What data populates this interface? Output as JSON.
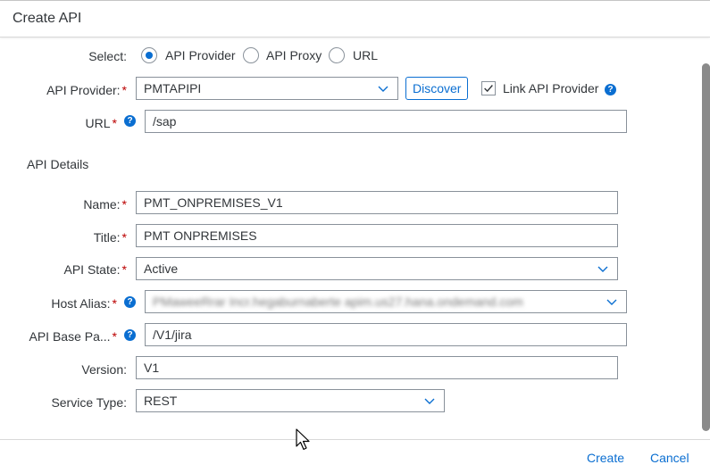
{
  "dialog": {
    "title": "Create API"
  },
  "select_row": {
    "label": "Select:",
    "options": [
      "API Provider",
      "API Proxy",
      "URL"
    ],
    "selected": "API Provider"
  },
  "api_provider": {
    "label": "API Provider:",
    "required": "*",
    "value": "PMTAPIPI",
    "discover_label": "Discover",
    "link_checkbox_label": "Link API Provider",
    "link_checked": true
  },
  "url": {
    "label": "URL",
    "required": "*",
    "value": "/sap"
  },
  "api_details": {
    "section_title": "API Details",
    "name": {
      "label": "Name:",
      "required": "*",
      "value": "PMT_ONPREMISES_V1"
    },
    "title": {
      "label": "Title:",
      "required": "*",
      "value": "PMT ONPREMISES"
    },
    "api_state": {
      "label": "API State:",
      "required": "*",
      "value": "Active"
    },
    "host_alias": {
      "label": "Host Alias:",
      "required": "*",
      "value": "PMaweeRrar Incr.hegaburnaberte apim.us27.hana.ondemand.com"
    },
    "base_path": {
      "label": "API Base Pa...",
      "required": "*",
      "value": "/V1/jira"
    },
    "version": {
      "label": "Version:",
      "value": "V1"
    },
    "service_type": {
      "label": "Service Type:",
      "value": "REST"
    }
  },
  "footer": {
    "create_label": "Create",
    "cancel_label": "Cancel"
  },
  "colors": {
    "accent": "#0a6ed1",
    "required": "#bb0000",
    "text": "#32363a",
    "border": "#89919a"
  },
  "icons": {
    "help": "question-circle-icon",
    "chevron": "chevron-down-icon",
    "check": "checkmark-icon",
    "cursor": "mouse-pointer-icon"
  }
}
